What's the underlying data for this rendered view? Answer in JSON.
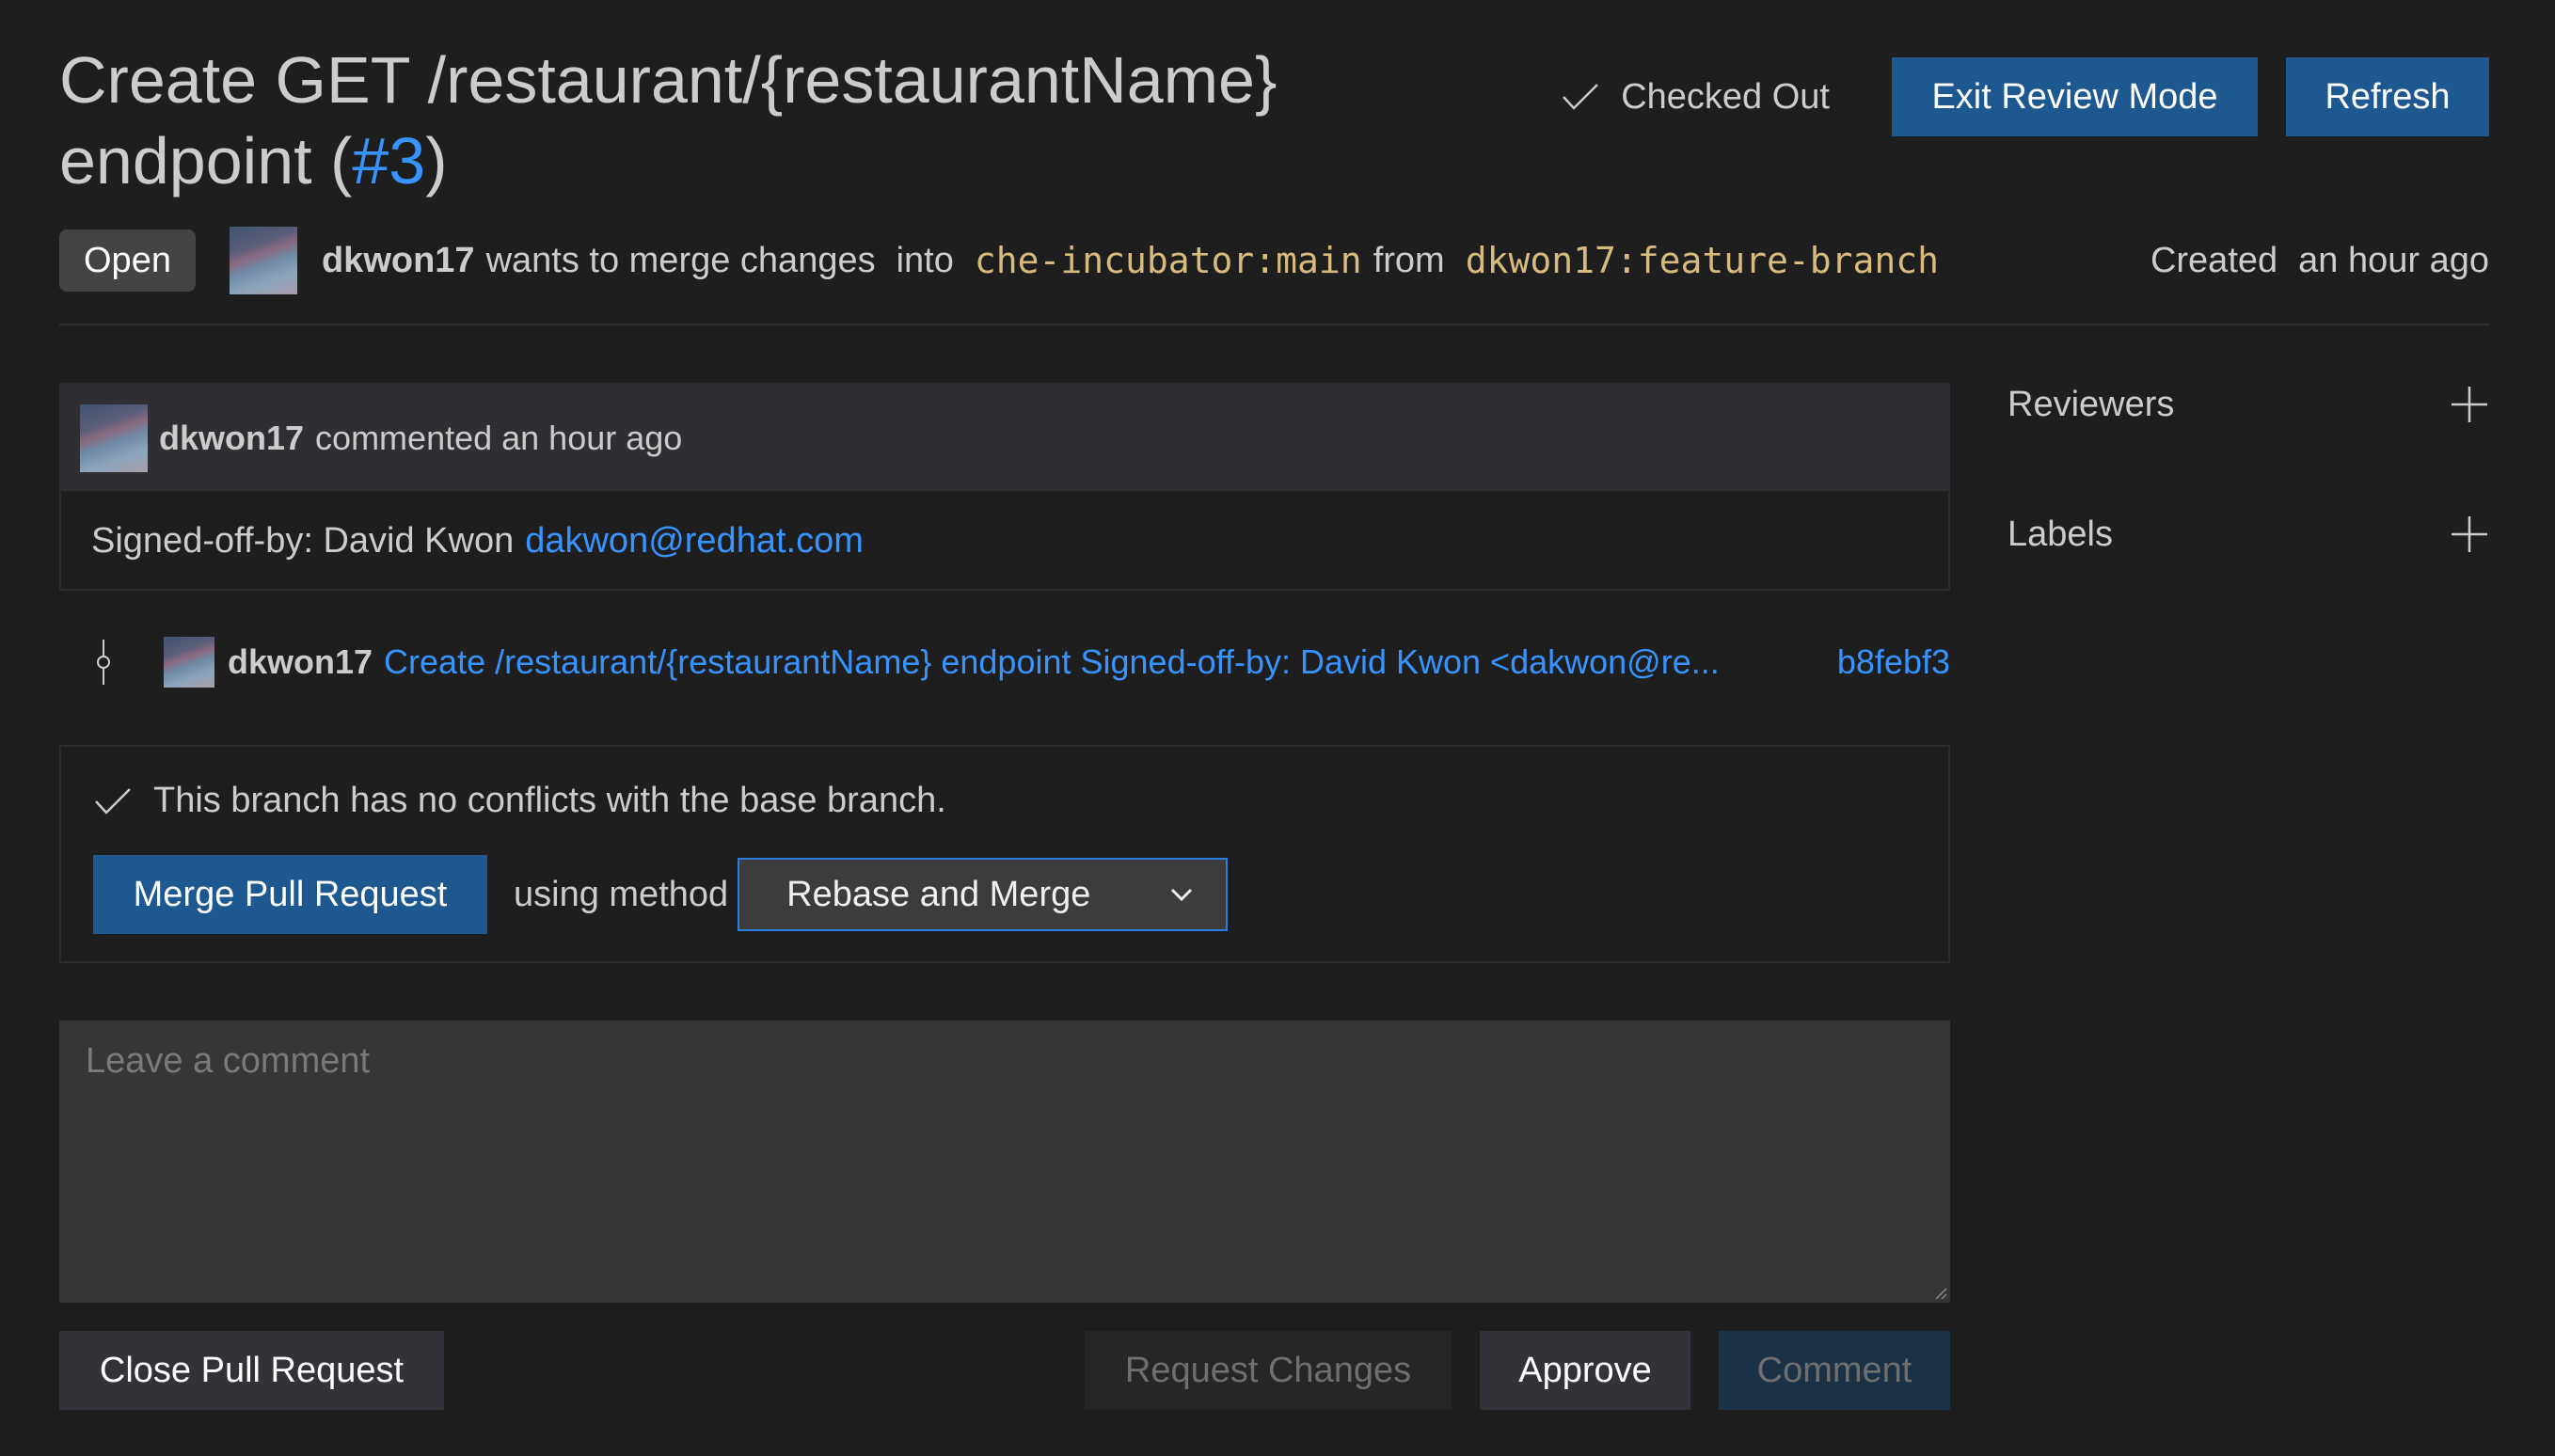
{
  "header": {
    "title_text": "Create GET /restaurant/{restaurantName} endpoint (",
    "title_number": "#3",
    "title_close": ")",
    "checked_out_label": "Checked Out",
    "exit_review_label": "Exit Review Mode",
    "refresh_label": "Refresh"
  },
  "meta": {
    "status": "Open",
    "author": "dkwon17",
    "wants_text": "wants to merge changes",
    "into_text": "into",
    "base_branch": "che-incubator:main",
    "from_text": "from",
    "head_branch": "dkwon17:feature-branch",
    "created_label": "Created",
    "created_time": "an hour ago"
  },
  "comment": {
    "author": "dkwon17",
    "action": "commented an hour ago",
    "body_text": "Signed-off-by: David Kwon",
    "body_link": "dakwon@redhat.com"
  },
  "commit": {
    "author": "dkwon17",
    "message": "Create /restaurant/{restaurantName} endpoint Signed-off-by: David Kwon <dakwon@re...",
    "sha": "b8febf3"
  },
  "merge": {
    "status_text": "This branch has no conflicts with the base branch.",
    "merge_button": "Merge Pull Request",
    "using_method": "using method",
    "method_selected": "Rebase and Merge"
  },
  "compose": {
    "placeholder": "Leave a comment",
    "value": ""
  },
  "actions": {
    "close": "Close Pull Request",
    "request_changes": "Request Changes",
    "approve": "Approve",
    "comment": "Comment"
  },
  "sidebar": {
    "sections": [
      {
        "label": "Reviewers",
        "icon": "plus-icon"
      },
      {
        "label": "Labels",
        "icon": "plus-icon"
      }
    ]
  },
  "colors": {
    "background": "#1e1e1e",
    "accent": "#1e5891",
    "link": "#3794ff",
    "branch": "#d7ba7d"
  }
}
